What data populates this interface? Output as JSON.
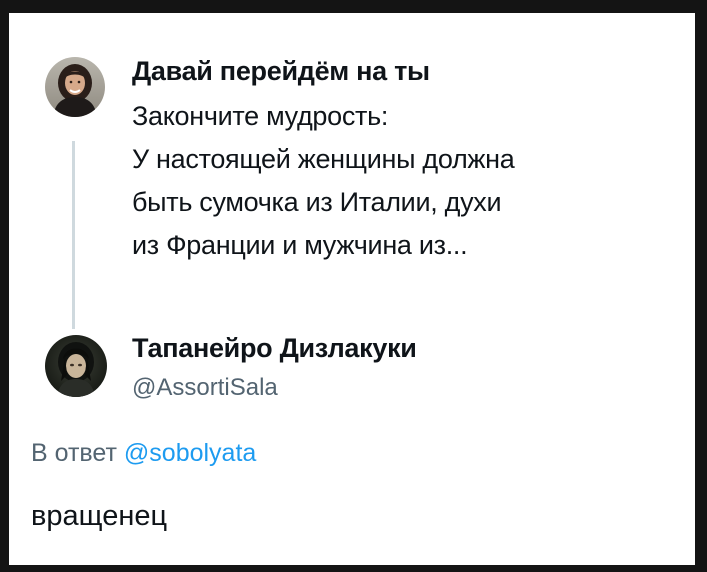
{
  "original_tweet": {
    "author_name": "Давай перейдём на ты",
    "avatar_icon": "person-avatar-icon",
    "text_lines": [
      "Закончите мудрость:",
      "У настоящей женщины должна",
      "быть сумочка из Италии, духи",
      "из Франции и мужчина из..."
    ]
  },
  "reply": {
    "author_name": "Тапанейро Дизлакуки",
    "handle": "@AssortiSala",
    "avatar_icon": "character-avatar-icon",
    "reply_prefix": "В ответ",
    "reply_mention": "@sobolyata",
    "text": "вращенец"
  },
  "colors": {
    "frame": "#141414",
    "background": "#ffffff",
    "text": "#0f1419",
    "secondary_text": "#536471",
    "mention": "#1d9bf0",
    "thread_line": "#cfd9de"
  }
}
